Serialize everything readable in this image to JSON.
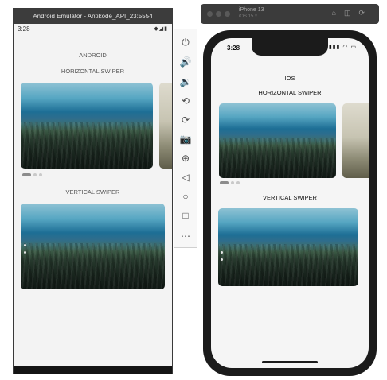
{
  "android_window": {
    "title": "Android Emulator - Antikode_API_23:5554",
    "status_time": "3:28",
    "status_icons": "◆◢▮",
    "app_header": "ANDROID",
    "horizontal_title": "HORIZONTAL SWIPER",
    "vertical_title": "VERTICAL SWIPER",
    "horizontal_pagination": {
      "count": 3,
      "active_index": 0
    },
    "vertical_pagination": {
      "count": 2,
      "active_index": 0
    }
  },
  "emulator_toolbar": {
    "buttons": [
      {
        "name": "power-icon",
        "glyph": "⏻"
      },
      {
        "name": "volume-up-icon",
        "glyph": "🔊"
      },
      {
        "name": "volume-down-icon",
        "glyph": "🔉"
      },
      {
        "name": "rotate-left-icon",
        "glyph": "⟲"
      },
      {
        "name": "rotate-right-icon",
        "glyph": "⟳"
      },
      {
        "name": "camera-icon",
        "glyph": "📷"
      },
      {
        "name": "zoom-icon",
        "glyph": "⊕"
      },
      {
        "name": "back-icon",
        "glyph": "◁"
      },
      {
        "name": "home-icon",
        "glyph": "○"
      },
      {
        "name": "overview-icon",
        "glyph": "□"
      },
      {
        "name": "more-icon",
        "glyph": "⋯"
      }
    ]
  },
  "ios_simulator": {
    "device_name": "iPhone 13",
    "device_os": "iOS 15.x",
    "status_time": "3:28",
    "status_icons": "▮▮▮ ◠ ▭",
    "app_header": "IOS",
    "horizontal_title": "HORIZONTAL SWIPER",
    "vertical_title": "VERTICAL SWIPER",
    "horizontal_pagination": {
      "count": 3,
      "active_index": 0
    },
    "vertical_pagination": {
      "count": 2,
      "active_index": 0
    }
  },
  "colors": {
    "emulator_titlebar": "#3c3c3c",
    "sky": "#56a6c2",
    "sea": "#1d6e95",
    "forest": "#1e2b23",
    "phone_frame": "#1b1b1b"
  }
}
